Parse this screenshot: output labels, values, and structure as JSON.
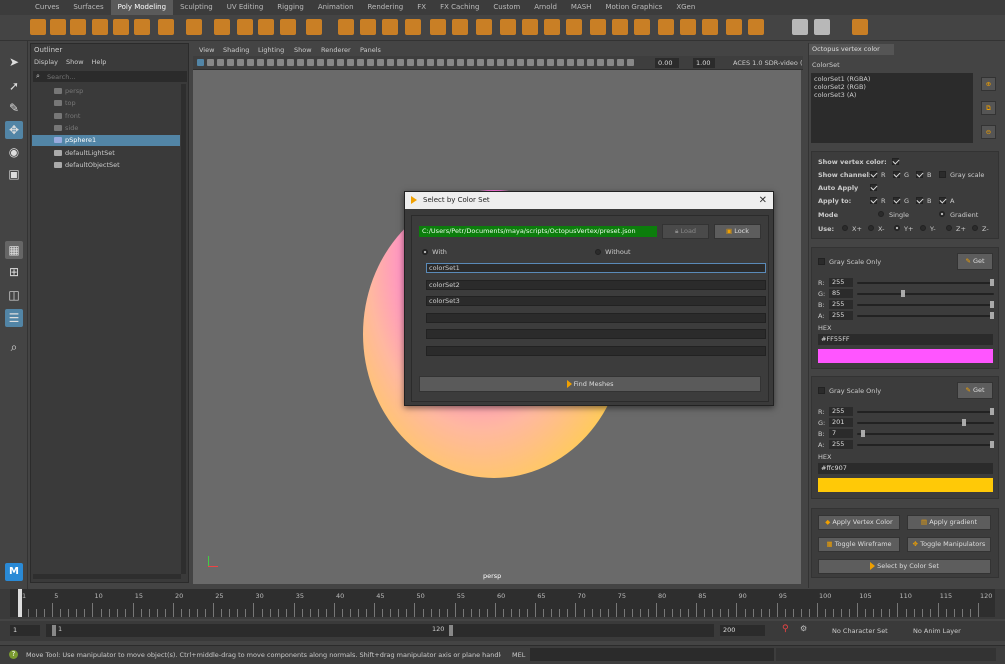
{
  "shelf_tabs": [
    "Curves",
    "Surfaces",
    "Poly Modeling",
    "Sculpting",
    "UV Editing",
    "Rigging",
    "Animation",
    "Rendering",
    "FX",
    "FX Caching",
    "Custom",
    "Arnold",
    "MASH",
    "Motion Graphics",
    "XGen"
  ],
  "shelf_active": "Poly Modeling",
  "outliner": {
    "title": "Outliner",
    "menu": [
      "Display",
      "Show",
      "Help"
    ],
    "search_placeholder": "Search...",
    "items": [
      "persp",
      "top",
      "front",
      "side",
      "pSphere1",
      "defaultLightSet",
      "defaultObjectSet"
    ],
    "selected": "pSphere1"
  },
  "viewport": {
    "menu": [
      "View",
      "Shading",
      "Lighting",
      "Show",
      "Renderer",
      "Panels"
    ],
    "near": "0.00",
    "far": "1.00",
    "color_space": "ACES 1.0 SDR-video (",
    "camera_label": "persp"
  },
  "dialog": {
    "title": "Select by Color Set",
    "path": "C:/Users/Petr/Documents/maya/scripts/OctopusVertex/preset.json",
    "load_label": "Load",
    "lock_label": "Lock",
    "with_label": "With",
    "without_label": "Without",
    "rows": [
      "colorSet1",
      "colorSet2",
      "colorSet3",
      "",
      "",
      ""
    ],
    "find_label": "Find Meshes"
  },
  "panel": {
    "tab_title": "Octopus vertex color",
    "colorset_heading": "ColorSet",
    "colorsets": [
      "colorSet1 (RGBA)",
      "colorSet2 (RGB)",
      "colorSet3 (A)"
    ],
    "show_vertex_color": "Show vertex color:",
    "show_channel": "Show channel:",
    "channels": [
      "R",
      "G",
      "B"
    ],
    "gray_scale": "Gray scale",
    "auto_apply": "Auto Apply",
    "apply_to": "Apply to:",
    "apply_channels": [
      "R",
      "G",
      "B",
      "A"
    ],
    "mode": "Mode",
    "single": "Single",
    "gradient": "Gradient",
    "use": "Use:",
    "use_opts": [
      "X+",
      "X-",
      "Y+",
      "Y-",
      "Z+",
      "Z-"
    ],
    "color1": {
      "gray_only": "Gray Scale Only",
      "get": "Get",
      "r": "255",
      "g": "85",
      "b": "255",
      "a": "255",
      "hex_label": "HEX",
      "hex": "#FF55FF",
      "swatch": "#ff55ff"
    },
    "color2": {
      "gray_only": "Gray Scale Only",
      "get": "Get",
      "r": "255",
      "g": "201",
      "b": "7",
      "a": "255",
      "hex_label": "HEX",
      "hex": "#ffc907",
      "swatch": "#ffc907"
    },
    "buttons": [
      "Apply Vertex Color",
      "Apply gradient",
      "Toggle Wireframe",
      "Toggle Manipulators",
      "Select by Color Set"
    ]
  },
  "timeline": {
    "ticks": [
      "1",
      "5",
      "10",
      "15",
      "20",
      "25",
      "30",
      "35",
      "40",
      "45",
      "50",
      "55",
      "60",
      "65",
      "70",
      "75",
      "80",
      "85",
      "90",
      "95",
      "100",
      "105",
      "110",
      "115",
      "120"
    ],
    "start": "1",
    "range_start": "1",
    "range_end": "120",
    "end": "200",
    "char_set": "No Character Set",
    "anim_layer": "No Anim Layer"
  },
  "status": {
    "message": "Move Tool: Use manipulator to move object(s). Ctrl+middle-drag to move components along normals. Shift+drag manipulator axis or plane handles to extrude components or c",
    "mel": "MEL"
  }
}
